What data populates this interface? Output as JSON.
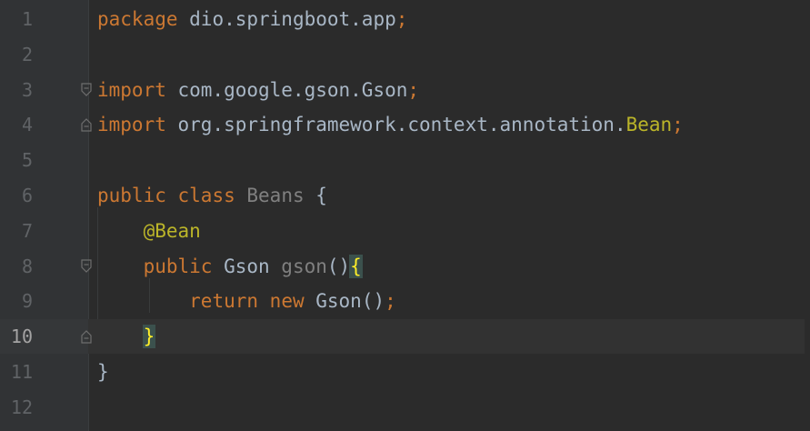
{
  "editor": {
    "colors": {
      "background": "#2b2b2b",
      "gutter": "#313335",
      "keyword": "#cc7832",
      "annotation": "#bbb529",
      "text": "#a9b7c6",
      "unused_class": "#808080",
      "line_number": "#606366",
      "current_line": "#323232"
    },
    "current_line": 10,
    "lines": [
      {
        "num": "1",
        "tokens": [
          {
            "t": "package",
            "c": "kw"
          },
          {
            "t": " dio.springboot.app",
            "c": "txt"
          },
          {
            "t": ";",
            "c": "kw"
          }
        ]
      },
      {
        "num": "2",
        "tokens": []
      },
      {
        "num": "3",
        "fold": "open",
        "tokens": [
          {
            "t": "import",
            "c": "kw"
          },
          {
            "t": " com.google.gson.Gson",
            "c": "txt"
          },
          {
            "t": ";",
            "c": "kw"
          }
        ]
      },
      {
        "num": "4",
        "fold": "close",
        "tokens": [
          {
            "t": "import",
            "c": "kw"
          },
          {
            "t": " org.springframework.context.annotation.",
            "c": "txt"
          },
          {
            "t": "Bean",
            "c": "ann"
          },
          {
            "t": ";",
            "c": "kw"
          }
        ]
      },
      {
        "num": "5",
        "tokens": []
      },
      {
        "num": "6",
        "tokens": [
          {
            "t": "public",
            "c": "kw"
          },
          {
            "t": " ",
            "c": "txt"
          },
          {
            "t": "class",
            "c": "kw"
          },
          {
            "t": " ",
            "c": "txt"
          },
          {
            "t": "Beans",
            "c": "gray"
          },
          {
            "t": " {",
            "c": "txt"
          }
        ]
      },
      {
        "num": "7",
        "tokens": [
          {
            "t": "    ",
            "c": "txt"
          },
          {
            "t": "@Bean",
            "c": "ann"
          }
        ]
      },
      {
        "num": "8",
        "fold": "open",
        "tokens": [
          {
            "t": "    ",
            "c": "txt"
          },
          {
            "t": "public",
            "c": "kw"
          },
          {
            "t": " Gson ",
            "c": "txt"
          },
          {
            "t": "gson",
            "c": "gray"
          },
          {
            "t": "()",
            "c": "txt"
          },
          {
            "t": "{",
            "c": "brace"
          }
        ]
      },
      {
        "num": "9",
        "tokens": [
          {
            "t": "        ",
            "c": "txt"
          },
          {
            "t": "return",
            "c": "kw"
          },
          {
            "t": " ",
            "c": "txt"
          },
          {
            "t": "new",
            "c": "kw"
          },
          {
            "t": " Gson()",
            "c": "txt"
          },
          {
            "t": ";",
            "c": "kw"
          }
        ]
      },
      {
        "num": "10",
        "fold": "close",
        "tokens": [
          {
            "t": "    ",
            "c": "txt"
          },
          {
            "t": "}",
            "c": "brace"
          }
        ]
      },
      {
        "num": "11",
        "tokens": [
          {
            "t": "}",
            "c": "txt"
          }
        ]
      },
      {
        "num": "12",
        "tokens": []
      }
    ]
  }
}
